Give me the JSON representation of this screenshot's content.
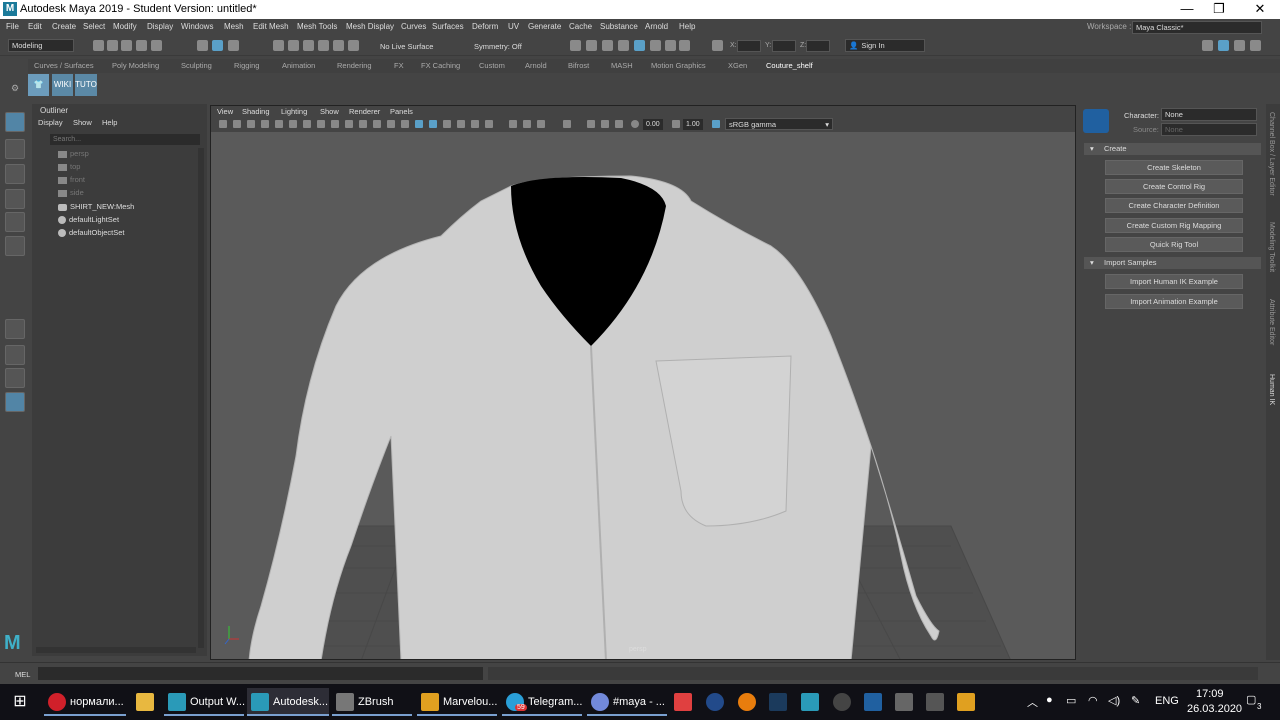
{
  "title": "Autodesk Maya 2019 - Student Version: untitled*",
  "window_buttons": [
    "—",
    "❐",
    "✕"
  ],
  "menu": [
    "File",
    "Edit",
    "Create",
    "Select",
    "Modify",
    "Display",
    "Windows",
    "Mesh",
    "Edit Mesh",
    "Mesh Tools",
    "Mesh Display",
    "Curves",
    "Surfaces",
    "Deform",
    "UV",
    "Generate",
    "Cache",
    "Substance",
    "Arnold",
    "Help"
  ],
  "workspace": {
    "label": "Workspace :",
    "value": "Maya Classic*"
  },
  "status": {
    "mode": "Modeling",
    "live_surface": "No Live Surface",
    "symmetry": "Symmetry: Off",
    "x_label": "X:",
    "y_label": "Y:",
    "z_label": "Z:",
    "sign_in": "Sign In"
  },
  "shelf_tabs": [
    "Curves / Surfaces",
    "Poly Modeling",
    "Sculpting",
    "Rigging",
    "Animation",
    "Rendering",
    "FX",
    "FX Caching",
    "Custom",
    "Arnold",
    "Bifrost",
    "MASH",
    "Motion Graphics",
    "XGen",
    "Couture_shelf"
  ],
  "shelf_buttons": [
    "WIKI",
    "TUTO"
  ],
  "outliner": {
    "tab": "Outliner",
    "menu": [
      "Display",
      "Show",
      "Help"
    ],
    "search_placeholder": "Search...",
    "items": [
      "persp",
      "top",
      "front",
      "side",
      "SHIRT_NEW:Mesh",
      "defaultLightSet",
      "defaultObjectSet"
    ]
  },
  "viewport": {
    "menu": [
      "View",
      "Shading",
      "Lighting",
      "Show",
      "Renderer",
      "Panels"
    ],
    "exposure": "0.00",
    "gamma": "1.00",
    "color_space": "sRGB gamma",
    "camera": "persp",
    "colors": {
      "background": "#5a5a5a",
      "shirt": "#cfcfcf",
      "neck": "#000000",
      "grid": "#444444"
    }
  },
  "hik": {
    "character_label": "Character:",
    "character_value": "None",
    "source_label": "Source:",
    "source_value": "None",
    "create_section": "Create",
    "create_buttons": [
      "Create Skeleton",
      "Create Control Rig",
      "Create Character Definition",
      "Create Custom Rig Mapping",
      "Quick Rig Tool"
    ],
    "import_section": "Import Samples",
    "import_buttons": [
      "Import Human IK Example",
      "Import Animation Example"
    ]
  },
  "side_tabs": [
    "Channel Box / Layer Editor",
    "Modeling Toolkit",
    "Attribute Editor",
    "Human IK"
  ],
  "mel_label": "MEL",
  "taskbar": {
    "apps": [
      "нормали...",
      "Output W...",
      "Autodesk...",
      "ZBrush",
      "Marvelou...",
      "Telegram...",
      "#maya - ..."
    ],
    "telegram_badge": "59",
    "lang": "ENG",
    "time": "17:09",
    "date": "26.03.2020",
    "notif_count": "3"
  }
}
